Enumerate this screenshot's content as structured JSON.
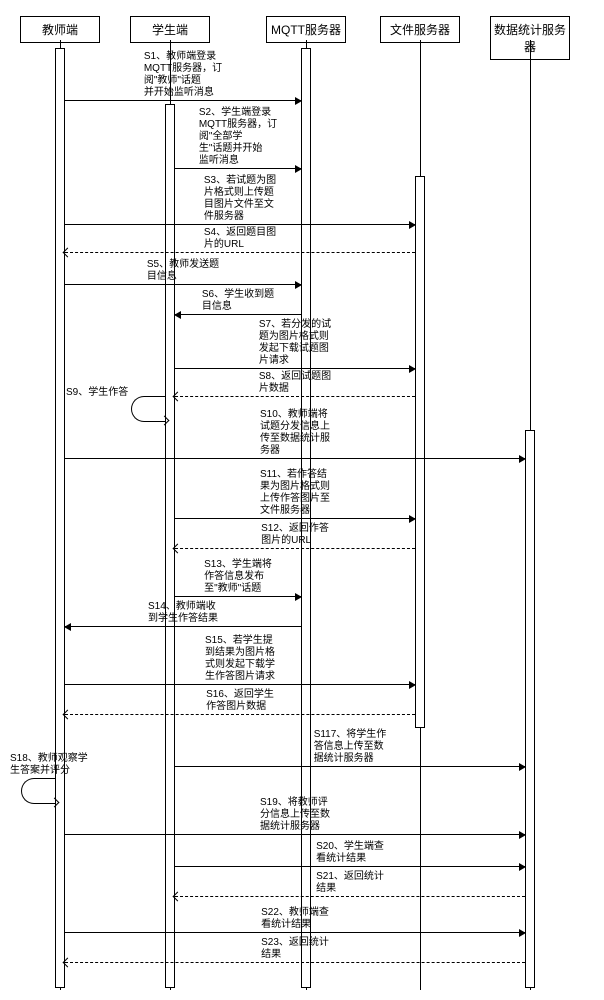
{
  "participants": {
    "teacher": "教师端",
    "student": "学生端",
    "mqtt": "MQTT服务器",
    "file": "文件服务器",
    "stats": "数据统计服务器"
  },
  "messages": {
    "s1": "S1、教师端登录\nMQTT服务器，订\n阅\"教师\"话题\n并开始监听消息",
    "s2": "S2、学生端登录\nMQTT服务器，订\n阅\"全部学\n生\"话题并开始\n监听消息",
    "s3": "S3、若试题为图\n片格式则上传题\n目图片文件至文\n件服务器",
    "s4": "S4、返回题目图\n片的URL",
    "s5": "S5、教师发送题\n目信息",
    "s6": "S6、学生收到题\n目信息",
    "s7": "S7、若分发的试\n题为图片格式则\n发起下载试题图\n片请求",
    "s8": "S8、返回试题图\n片数据",
    "s9": "S9、学生作答",
    "s10": "S10、教师端将\n试题分发信息上\n传至数据统计服\n务器",
    "s11": "S11、若作答结\n果为图片格式则\n上传作答图片至\n文件服务器",
    "s12": "S12、返回作答\n图片的URL",
    "s13": "S13、学生端将\n作答信息发布\n至\"教师\"话题",
    "s14": "S14、教师端收\n到学生作答结果",
    "s15": "S15、若学生提\n到结果为图片格\n式则发起下载学\n生作答图片请求",
    "s16": "S16、返回学生\n作答图片数据",
    "s117": "S117、将学生作\n答信息上传至数\n据统计服务器",
    "s18": "S18、教师观察学\n生答案并评分",
    "s19": "S19、将教师评\n分信息上传至数\n据统计服务器",
    "s20": "S20、学生端查\n看统计结果",
    "s21": "S21、返回统计\n结果",
    "s22": "S22、教师端查\n看统计结果",
    "s23": "S23、返回统计\n结果"
  }
}
